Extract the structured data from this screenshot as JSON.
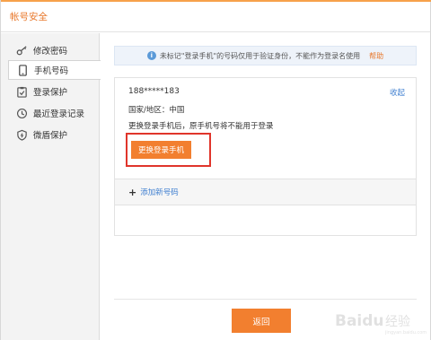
{
  "window": {
    "title": "帐号安全"
  },
  "sidebar": {
    "items": [
      {
        "label": "修改密码",
        "icon": "key-icon",
        "active": false
      },
      {
        "label": "手机号码",
        "icon": "phone-icon",
        "active": true
      },
      {
        "label": "登录保护",
        "icon": "clipboard-check-icon",
        "active": false
      },
      {
        "label": "最近登录记录",
        "icon": "history-icon",
        "active": false
      },
      {
        "label": "微盾保护",
        "icon": "shield-icon",
        "active": false
      }
    ]
  },
  "notice": {
    "icon": "info-icon",
    "text": "未标记\"登录手机\"的号码仅用于验证身份，不能作为登录名使用",
    "help_label": "帮助"
  },
  "phone_card": {
    "number": "188*****183",
    "collapse_label": "收起",
    "region": "国家/地区：中国",
    "warning": "更换登录手机后，原手机号将不能用于登录",
    "change_button": "更换登录手机"
  },
  "add_number": {
    "label": "添加新号码"
  },
  "footer": {
    "back_button": "返回"
  },
  "watermark": {
    "text": "Baidu经验"
  },
  "colors": {
    "accent": "#f27f2f",
    "link": "#3f7fd0",
    "highlight": "#e0352b",
    "title": "#e8772a"
  }
}
